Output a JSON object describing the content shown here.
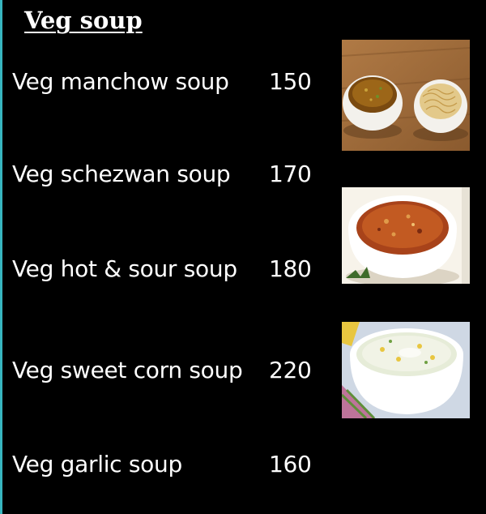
{
  "menu": {
    "title": "Veg soup",
    "items": [
      {
        "name": "Veg manchow soup",
        "price": "150",
        "image": "manchow-soup-photo"
      },
      {
        "name": "Veg schezwan soup",
        "price": "170",
        "image": "schezwan-soup-photo"
      },
      {
        "name": "Veg hot & sour soup",
        "price": "180",
        "image": null
      },
      {
        "name": "Veg sweet corn soup",
        "price": "220",
        "image": "sweet-corn-soup-photo"
      },
      {
        "name": "Veg garlic soup",
        "price": "160",
        "image": null
      }
    ]
  },
  "colors": {
    "background": "#000000",
    "text": "#ffffff",
    "edge_accent": "#38b6c0"
  }
}
